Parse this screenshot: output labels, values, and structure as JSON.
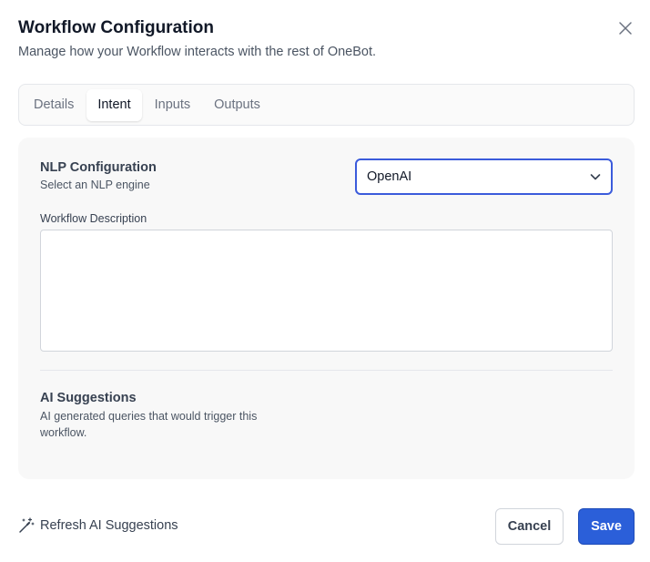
{
  "dialog": {
    "title": "Workflow Configuration",
    "subtitle": "Manage how your Workflow interacts with the rest of OneBot."
  },
  "tabs": [
    {
      "label": "Details",
      "active": false
    },
    {
      "label": "Intent",
      "active": true
    },
    {
      "label": "Inputs",
      "active": false
    },
    {
      "label": "Outputs",
      "active": false
    }
  ],
  "nlp": {
    "title": "NLP Configuration",
    "subtitle": "Select an NLP engine",
    "selected": "OpenAI"
  },
  "description": {
    "label": "Workflow Description",
    "value": ""
  },
  "ai_suggestions": {
    "title": "AI Suggestions",
    "subtitle": "AI generated queries that would trigger this workflow."
  },
  "footer": {
    "refresh_label": "Refresh AI Suggestions",
    "cancel_label": "Cancel",
    "save_label": "Save"
  },
  "colors": {
    "accent": "#2b5fd9",
    "focus_border": "#3b5bdb",
    "panel_bg": "#f8f8f8"
  },
  "icons": {
    "close": "close-icon",
    "select_caret": "chevron-down-icon",
    "refresh": "magic-wand-icon"
  }
}
